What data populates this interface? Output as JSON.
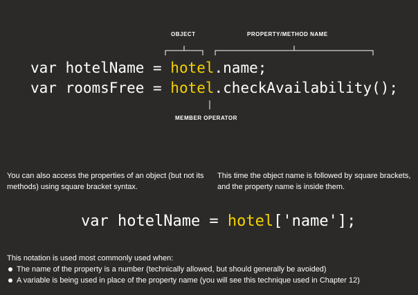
{
  "labels": {
    "object": "OBJECT",
    "property": "PROPERTY/METHOD NAME",
    "member": "MEMBER OPERATOR"
  },
  "code": {
    "line1": {
      "prefix": "var hotelName = ",
      "object": "hotel",
      "suffix": ".name;"
    },
    "line2": {
      "prefix": "var roomsFree = ",
      "object": "hotel",
      "suffix": ".checkAvailability();"
    },
    "line3": {
      "prefix": "var hotelName = ",
      "object": "hotel",
      "suffix": "['name'];"
    }
  },
  "paragraphs": {
    "left": "You can also access the properties of an object (but not its methods) using square bracket syntax.",
    "right": "This time the object name is followed by square brackets, and the property name is inside them."
  },
  "notation": {
    "intro": "This notation is used most commonly used when:",
    "bullets": [
      "The name of the property is a number (technically allowed, but should generally be avoided)",
      "A variable is being used in place of the property name (you will see this technique used in Chapter 12)"
    ]
  },
  "colors": {
    "background": "#2b2a29",
    "highlight": "#f5d300",
    "text": "#ffffff"
  }
}
